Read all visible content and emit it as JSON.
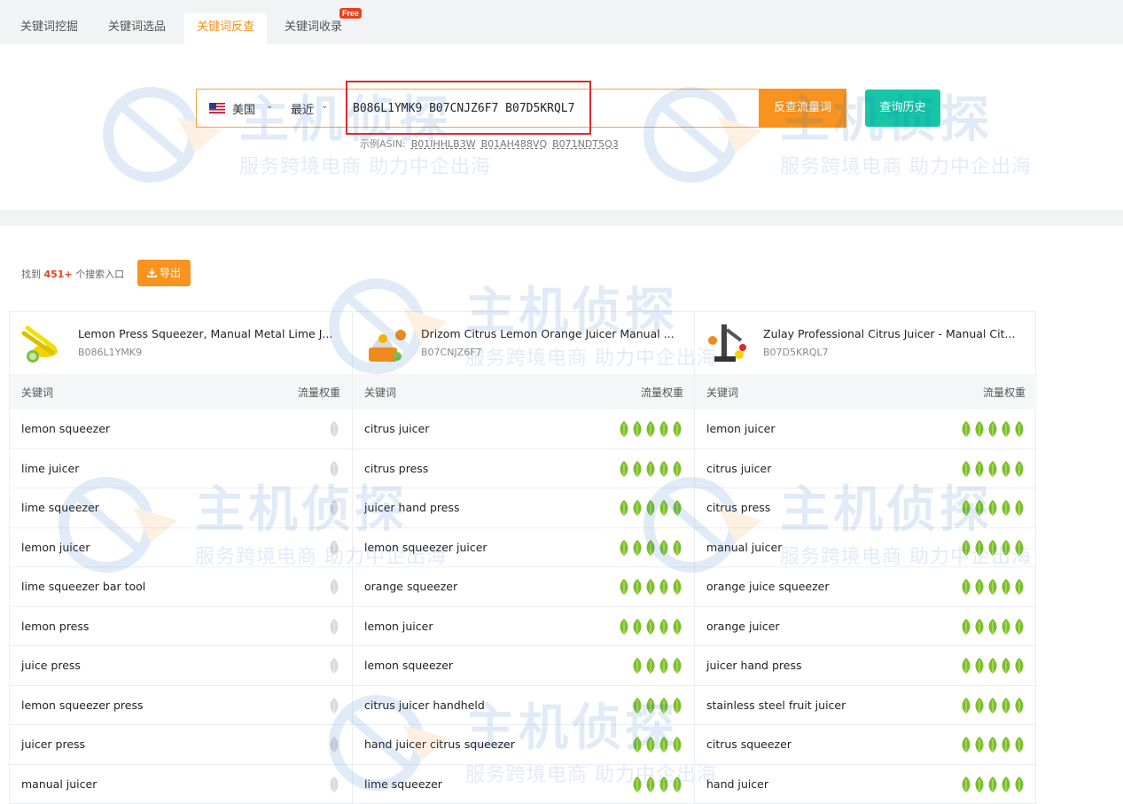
{
  "tabs": [
    {
      "label": "关键词挖掘",
      "active": false
    },
    {
      "label": "关键词选品",
      "active": false
    },
    {
      "label": "关键词反查",
      "active": true
    },
    {
      "label": "关键词收录",
      "active": false,
      "badge": "Free"
    }
  ],
  "search": {
    "country": "美国",
    "country_icon": "us-flag-icon",
    "time_range": "最近",
    "query": "B086L1YMK9 B07CNJZ6F7 B07D5KRQL7",
    "reverse_button": "反查流量词",
    "history_button": "查询历史",
    "examples_label": "示例ASIN:",
    "examples": [
      "B01IHHLB3W",
      "B01AH488VQ",
      "B071NDT5Q3"
    ]
  },
  "results": {
    "found_prefix": "找到",
    "found_count": "451+",
    "found_suffix": "个搜索入口",
    "export_button": "导出",
    "export_icon": "download-icon",
    "column_keyword_header": "关键词",
    "column_weight_header": "流量权重",
    "colors": {
      "accent": "#f7931e",
      "teal": "#16c6a6",
      "leaf_green": "#7cbf2a",
      "leaf_grey": "#d9d9d9"
    },
    "products": [
      {
        "title": "Lemon Press Squeezer, Manual Metal Lime J...",
        "asin": "B086L1YMK9",
        "keywords": [
          {
            "kw": "lemon squeezer",
            "weight": 0
          },
          {
            "kw": "lime juicer",
            "weight": 0
          },
          {
            "kw": "lime squeezer",
            "weight": 0
          },
          {
            "kw": "lemon juicer",
            "weight": 0
          },
          {
            "kw": "lime squeezer bar tool",
            "weight": 0
          },
          {
            "kw": "lemon press",
            "weight": 0
          },
          {
            "kw": "juice press",
            "weight": 0
          },
          {
            "kw": "lemon squeezer press",
            "weight": 0
          },
          {
            "kw": "juicer press",
            "weight": 0
          },
          {
            "kw": "manual juicer",
            "weight": 0
          }
        ]
      },
      {
        "title": "Drizom Citrus Lemon Orange Juicer Manual ...",
        "asin": "B07CNJZ6F7",
        "keywords": [
          {
            "kw": "citrus juicer",
            "weight": 5
          },
          {
            "kw": "citrus press",
            "weight": 5
          },
          {
            "kw": "juicer hand press",
            "weight": 5
          },
          {
            "kw": "lemon squeezer juicer",
            "weight": 5
          },
          {
            "kw": "orange squeezer",
            "weight": 5
          },
          {
            "kw": "lemon juicer",
            "weight": 5
          },
          {
            "kw": "lemon squeezer",
            "weight": 4
          },
          {
            "kw": "citrus juicer handheld",
            "weight": 4
          },
          {
            "kw": "hand juicer citrus squeezer",
            "weight": 4
          },
          {
            "kw": "lime squeezer",
            "weight": 4
          }
        ]
      },
      {
        "title": "Zulay Professional Citrus Juicer - Manual Cit...",
        "asin": "B07D5KRQL7",
        "keywords": [
          {
            "kw": "lemon juicer",
            "weight": 5
          },
          {
            "kw": "citrus juicer",
            "weight": 5
          },
          {
            "kw": "citrus press",
            "weight": 5
          },
          {
            "kw": "manual juicer",
            "weight": 5
          },
          {
            "kw": "orange juice squeezer",
            "weight": 5
          },
          {
            "kw": "orange juicer",
            "weight": 5
          },
          {
            "kw": "juicer hand press",
            "weight": 5
          },
          {
            "kw": "stainless steel fruit juicer",
            "weight": 5
          },
          {
            "kw": "citrus squeezer",
            "weight": 5
          },
          {
            "kw": "hand juicer",
            "weight": 5
          }
        ]
      }
    ]
  },
  "watermark": {
    "brand": "主机侦探",
    "slogan": "服务跨境电商 助力中企出海"
  }
}
